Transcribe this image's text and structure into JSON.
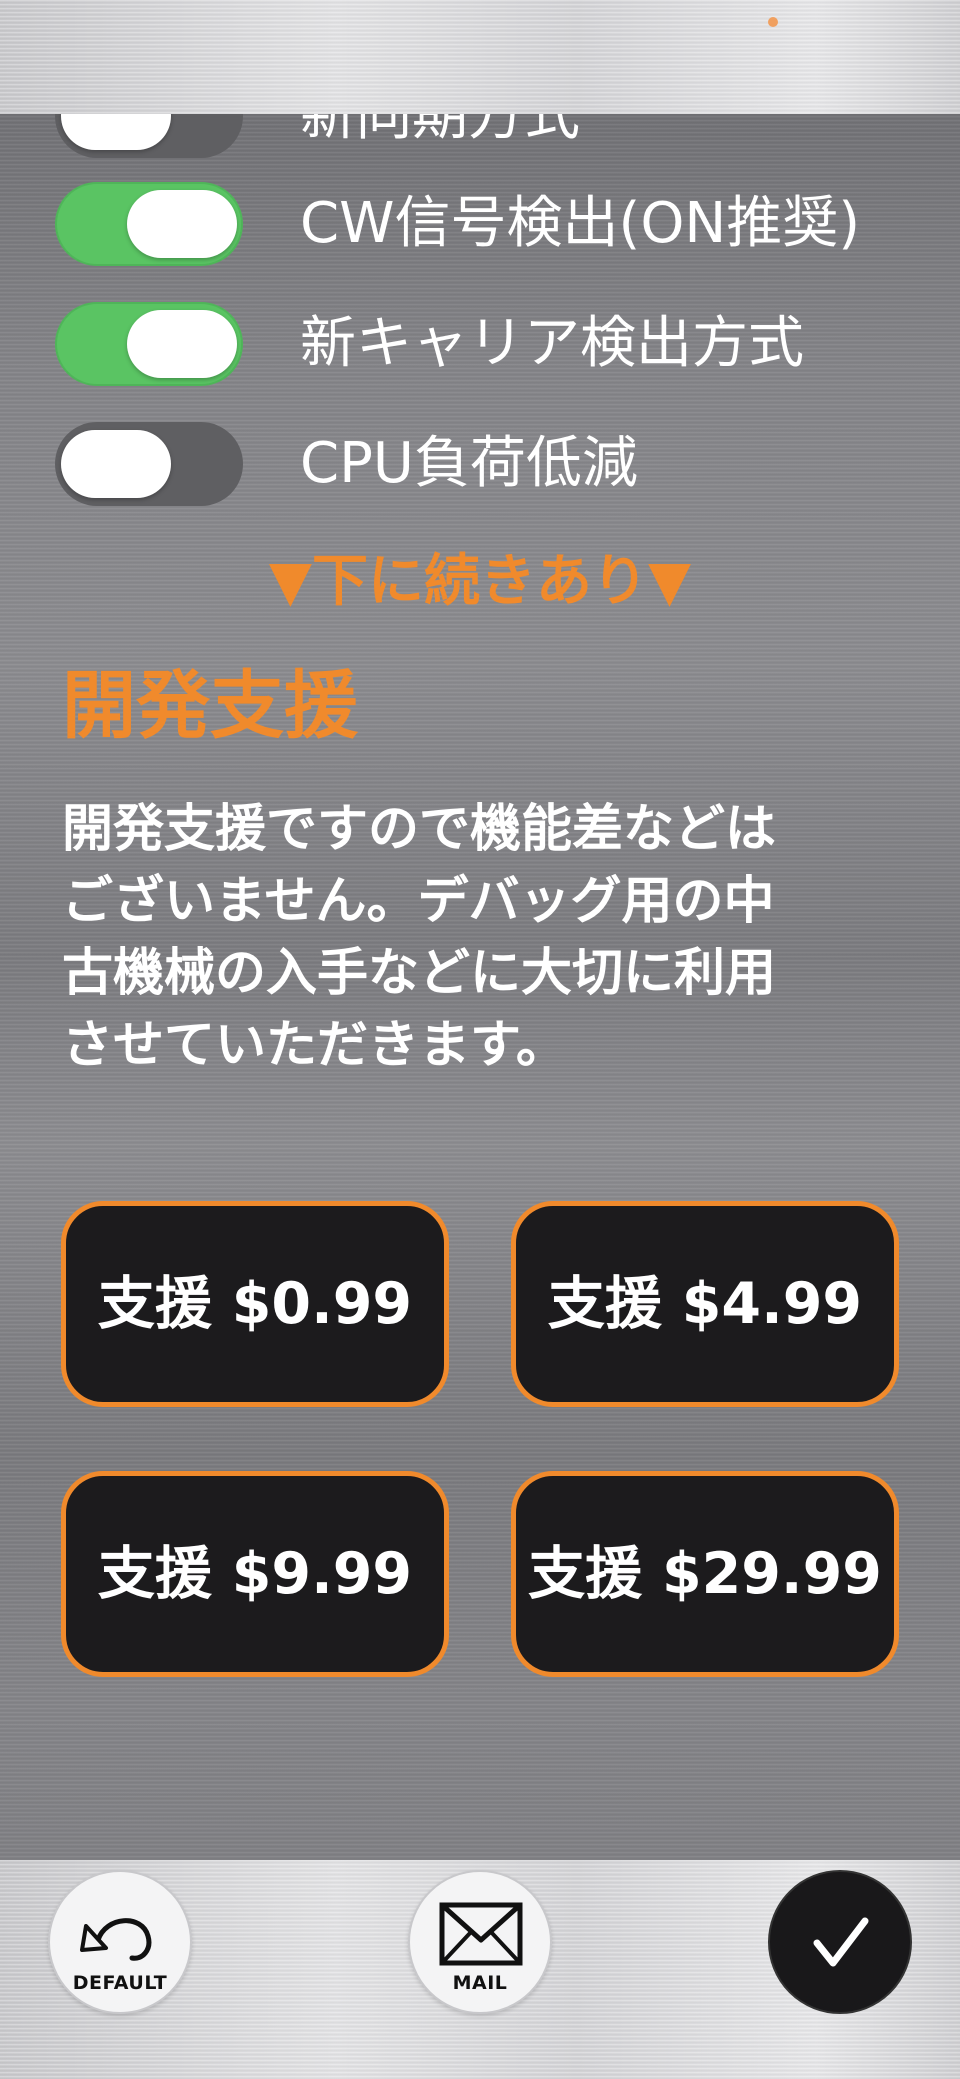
{
  "colors": {
    "accent": "#f08a2c",
    "toggle_on": "#5ac463",
    "toggle_off": "#5f5f62",
    "button_bg": "#1c1b1d",
    "status_dot": "#f0a060"
  },
  "settings": {
    "partial_label": "新同期方式",
    "toggles": [
      {
        "label": "CW信号検出(ON推奨)",
        "state": true
      },
      {
        "label": "新キャリア検出方式",
        "state": true
      },
      {
        "label": "CPU負荷低減",
        "state": false
      }
    ],
    "more_indicator": "▼下に続きあり▼"
  },
  "support": {
    "title": "開発支援",
    "description_lines": [
      "開発支援ですので機能差などは",
      "ございません。デバッグ用の中",
      "古機械の入手などに大切に利用",
      "させていただきます。"
    ],
    "buttons": [
      {
        "label": "支援 $0.99"
      },
      {
        "label": "支援 $4.99"
      },
      {
        "label": "支援 $9.99"
      },
      {
        "label": "支援 $29.99"
      }
    ]
  },
  "toolbar": {
    "default_label": "DEFAULT",
    "mail_label": "MAIL",
    "done_icon": "checkmark-icon"
  }
}
